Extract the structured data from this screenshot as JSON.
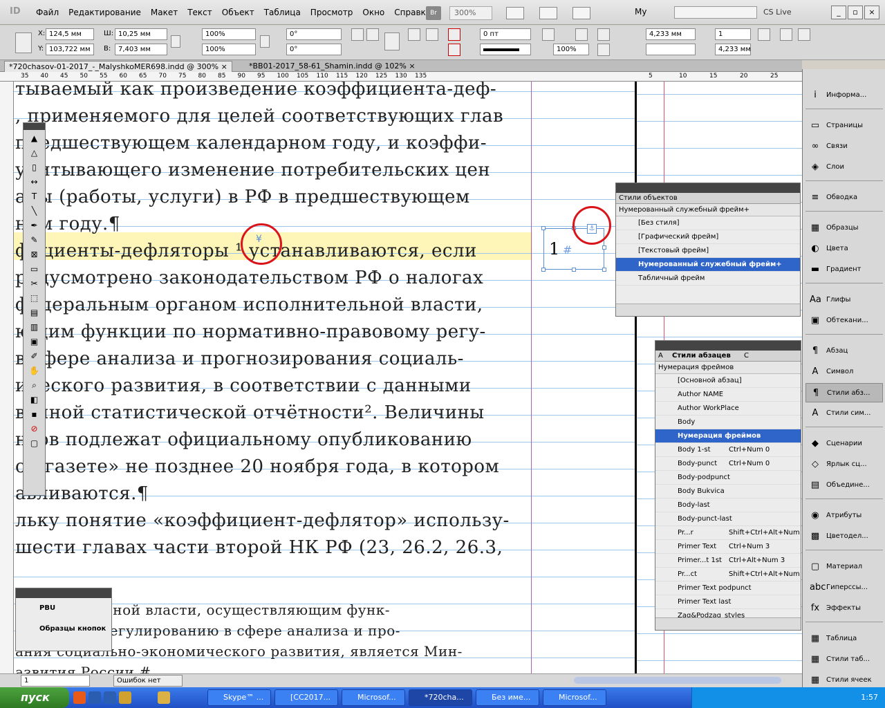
{
  "menubar": {
    "logo": "ID",
    "menus": [
      "Файл",
      "Редактирование",
      "Макет",
      "Текст",
      "Объект",
      "Таблица",
      "Просмотр",
      "Окно",
      "Справка"
    ],
    "bridge": "Br",
    "zoom": "300%",
    "workspace": "My",
    "cslive": "CS Live"
  },
  "control": {
    "x_label": "X:",
    "x": "124,5 мм",
    "y_label": "Y:",
    "y": "103,722 мм",
    "w_label": "Ш:",
    "w": "10,25 мм",
    "h_label": "В:",
    "h": "7,403 мм",
    "scale_x": "100%",
    "scale_y": "100%",
    "angle": "0°",
    "shear": "0°",
    "stroke_weight": "0 пт",
    "opacity": "100%",
    "dim1": "4,233 мм",
    "cols": "1",
    "dim2": "4,233 мм"
  },
  "tabs": [
    {
      "label": "*720chasov-01-2017_-_MalyshkoMER698.indd @ 300%",
      "close": "×"
    },
    {
      "label": "*BB01-2017_58-61_Shamin.indd @ 102%",
      "close": "×"
    }
  ],
  "ruler": [
    "35",
    "40",
    "45",
    "50",
    "55",
    "60",
    "65",
    "70",
    "75",
    "80",
    "85",
    "90",
    "95",
    "100",
    "105",
    "110",
    "115",
    "120",
    "125",
    "130",
    "135",
    "5",
    "10",
    "15",
    "20",
    "25"
  ],
  "document": {
    "lines": [
      "тываемый как произведение коэффициента-деф-",
      ", применяемого для целей соответствующих глав",
      "предшествующем календарном году, и коэффи-",
      "учитывающего изменение потребительских цен",
      "ары (работы, услуги) в РФ в предшествующем",
      "ном году.¶",
      "фициенты-дефляторы ¹ устанавливаются, если",
      "редусмотрено законодательством РФ о налогах",
      "федеральным органом исполнительной власти,",
      "ющим функции по нормативно-правовому регу-",
      "в сфере анализа и прогнозирования социаль-",
      "ического развития, в соответствии с данными",
      "венной статистической отчётности². Величины",
      "нтов подлежат официальному опубликованию",
      "ой газете» не позднее 20 ноября года, в котором",
      "авливаются.¶",
      "льку понятие «коэффициент-дефлятор» использу-",
      "шести главах части второй НК РФ (23, 26.2, 26.3,"
    ],
    "footnote_lines": [
      "исполнительной власти, осуществляющим функ-",
      "правовому регулированию в сфере анализа и про-",
      "ания социально-экономического развития, является Мин-",
      "азвития России.#"
    ],
    "frame_number": "1",
    "frame_hash": "#",
    "anchor_marker": "¥"
  },
  "object_styles": {
    "title": "Стили объектов",
    "current": "Нумерованный служебный фрейм+",
    "items": [
      "[Без стиля]",
      "[Графический фрейм]",
      "[Текстовый фрейм]",
      "Нумерованный служебный фрейм+",
      "Табличный фрейм"
    ],
    "selected": 3
  },
  "para_styles": {
    "tab_a": "А",
    "title": "Стили абзацев",
    "tab_c": "С",
    "current": "Нумерация фреймов",
    "items": [
      {
        "name": "[Основной абзац]",
        "shortcut": ""
      },
      {
        "name": "Author NAME",
        "shortcut": ""
      },
      {
        "name": "Author WorkPlace",
        "shortcut": ""
      },
      {
        "name": "Body",
        "shortcut": ""
      },
      {
        "name": "Нумерация фреймов",
        "shortcut": ""
      },
      {
        "name": "Body 1-st",
        "shortcut": "Ctrl+Num 0"
      },
      {
        "name": "Body-punct",
        "shortcut": "Ctrl+Num 0"
      },
      {
        "name": "Body-podpunct",
        "shortcut": ""
      },
      {
        "name": "Body Bukvica",
        "shortcut": ""
      },
      {
        "name": "Body-last",
        "shortcut": ""
      },
      {
        "name": "Body-punct-last",
        "shortcut": ""
      },
      {
        "name": "Pr...r",
        "shortcut": "Shift+Ctrl+Alt+Num 3"
      },
      {
        "name": "Primer Text",
        "shortcut": "Ctrl+Num 3"
      },
      {
        "name": "Primer...t 1st",
        "shortcut": "Ctrl+Alt+Num 3"
      },
      {
        "name": "Pr...ct",
        "shortcut": "Shift+Ctrl+Alt+Num 0"
      },
      {
        "name": "Primer Text podpunct",
        "shortcut": ""
      },
      {
        "name": "Primer Text last",
        "shortcut": ""
      },
      {
        "name": "Zag&Podzag_styles",
        "shortcut": ""
      }
    ],
    "selected": 4
  },
  "small_panel": {
    "items": [
      "PBU",
      "Образцы кнопок"
    ]
  },
  "right_panel": [
    {
      "label": "Информа...",
      "icon": "i"
    },
    {
      "label": "Страницы",
      "icon": "▭"
    },
    {
      "label": "Связи",
      "icon": "∞"
    },
    {
      "label": "Слои",
      "icon": "◈"
    },
    {
      "label": "Обводка",
      "icon": "≡"
    },
    {
      "label": "Образцы",
      "icon": "▦"
    },
    {
      "label": "Цвета",
      "icon": "◐"
    },
    {
      "label": "Градиент",
      "icon": "▬"
    },
    {
      "label": "Глифы",
      "icon": "Aa"
    },
    {
      "label": "Обтекани...",
      "icon": "▣"
    },
    {
      "label": "Абзац",
      "icon": "¶"
    },
    {
      "label": "Символ",
      "icon": "A"
    },
    {
      "label": "Стили абз...",
      "icon": "¶"
    },
    {
      "label": "Стили сим...",
      "icon": "A"
    },
    {
      "label": "Сценарии",
      "icon": "◆"
    },
    {
      "label": "Ярлык сц...",
      "icon": "◇"
    },
    {
      "label": "Объедине...",
      "icon": "▤"
    },
    {
      "label": "Атрибуты",
      "icon": "◉"
    },
    {
      "label": "Цветодел...",
      "icon": "▩"
    },
    {
      "label": "Материал",
      "icon": "▢"
    },
    {
      "label": "Гиперссы...",
      "icon": "abc"
    },
    {
      "label": "Эффекты",
      "icon": "fx"
    },
    {
      "label": "Таблица",
      "icon": "▦"
    },
    {
      "label": "Стили таб...",
      "icon": "▦"
    },
    {
      "label": "Стили ячеек",
      "icon": "▦"
    }
  ],
  "status": {
    "page": "1",
    "errors": "Ошибок нет"
  },
  "taskbar": {
    "start": "пуск",
    "tasks": [
      "Skype™ ...",
      "[CC2017...",
      "Microsof...",
      "*720cha...",
      "Без име...",
      "Microsof..."
    ],
    "active": 3,
    "clock": "1:57"
  },
  "colors": {
    "selection": "#2f64c8",
    "highlight": "#fdf6b8",
    "annotation": "#d9141b",
    "guide": "#9cc7ea"
  }
}
